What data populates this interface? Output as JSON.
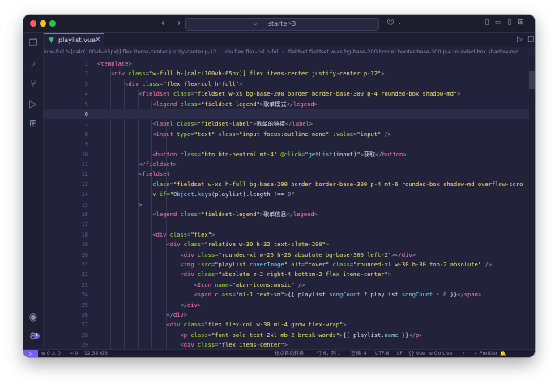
{
  "window": {
    "title": "starter-3"
  },
  "tab": {
    "filename": "playlist.vue",
    "close": "×",
    "icon": "vue-file-icon"
  },
  "breadcrumbs": [
    "iv.w-full.h-[calc(100vh-65px)].flex.items-center.justify-center.p-12",
    "div.flex.flex-col.h-full",
    "fieldset.fieldset.w-xs.bg-base-200.border.border-base-300.p-4.rounded-box.shadow-md"
  ],
  "editor": {
    "current_line": 6,
    "lines": [
      {
        "n": 1,
        "t": [
          [
            "<",
            "p"
          ],
          [
            "template",
            "tag"
          ],
          [
            ">",
            "p"
          ]
        ]
      },
      {
        "n": 2,
        "t": [
          [
            "    ",
            ""
          ],
          [
            "<",
            "p"
          ],
          [
            "div ",
            "tag"
          ],
          [
            "class",
            "attr"
          ],
          [
            "=",
            "p"
          ],
          [
            "\"w-full h-[calc(100vh-65px)] flex items-center justify-center p-12\"",
            "str"
          ],
          [
            ">",
            "p"
          ]
        ]
      },
      {
        "n": 3,
        "t": [
          [
            "        ",
            ""
          ],
          [
            "<",
            "p"
          ],
          [
            "div ",
            "tag"
          ],
          [
            "class",
            "attr"
          ],
          [
            "=",
            "p"
          ],
          [
            "\"flex flex-col h-full\"",
            "str"
          ],
          [
            ">",
            "p"
          ]
        ]
      },
      {
        "n": 4,
        "t": [
          [
            "            ",
            ""
          ],
          [
            "<",
            "p"
          ],
          [
            "fieldset ",
            "tag"
          ],
          [
            "class",
            "attr"
          ],
          [
            "=",
            "p"
          ],
          [
            "\"fieldset w-xs bg-base-200 border border-base-300 p-4 rounded-box shadow-md\"",
            "str"
          ],
          [
            ">",
            "p"
          ]
        ]
      },
      {
        "n": 5,
        "t": [
          [
            "                ",
            ""
          ],
          [
            "<",
            "p"
          ],
          [
            "legend ",
            "tag"
          ],
          [
            "class",
            "attr"
          ],
          [
            "=",
            "p"
          ],
          [
            "\"fieldset-legend\"",
            "str"
          ],
          [
            ">",
            "p"
          ],
          [
            "歌单模式",
            "txt"
          ],
          [
            "</",
            "p"
          ],
          [
            "legend",
            "tag"
          ],
          [
            ">",
            "p"
          ]
        ]
      },
      {
        "n": 6,
        "t": []
      },
      {
        "n": 7,
        "t": [
          [
            "                ",
            ""
          ],
          [
            "<",
            "p"
          ],
          [
            "label ",
            "tag"
          ],
          [
            "class",
            "attr"
          ],
          [
            "=",
            "p"
          ],
          [
            "\"fieldset-label\"",
            "str"
          ],
          [
            ">",
            "p"
          ],
          [
            "歌单的链接",
            "txt"
          ],
          [
            "</",
            "p"
          ],
          [
            "label",
            "tag"
          ],
          [
            ">",
            "p"
          ]
        ]
      },
      {
        "n": 8,
        "t": [
          [
            "                ",
            ""
          ],
          [
            "<",
            "p"
          ],
          [
            "input ",
            "tag"
          ],
          [
            "type",
            "attr"
          ],
          [
            "=",
            "p"
          ],
          [
            "\"text\" ",
            "str"
          ],
          [
            "class",
            "attr"
          ],
          [
            "=",
            "p"
          ],
          [
            "\"input focus:outline-none\" ",
            "str"
          ],
          [
            ":value",
            "attr"
          ],
          [
            "=",
            "p"
          ],
          [
            "\"input\"",
            "str"
          ],
          [
            " />",
            "p"
          ]
        ]
      },
      {
        "n": 9,
        "t": []
      },
      {
        "n": 10,
        "t": [
          [
            "                ",
            ""
          ],
          [
            "<",
            "p"
          ],
          [
            "button ",
            "tag"
          ],
          [
            "class",
            "attr"
          ],
          [
            "=",
            "p"
          ],
          [
            "\"btn btn-neutral mt-4\" ",
            "str"
          ],
          [
            "@click",
            "attr"
          ],
          [
            "=",
            "p"
          ],
          [
            "\"",
            "str"
          ],
          [
            "getList",
            "fn"
          ],
          [
            "(input)",
            "txt"
          ],
          [
            "\"",
            "str"
          ],
          [
            ">",
            "p"
          ],
          [
            "获取",
            "txt"
          ],
          [
            "</",
            "p"
          ],
          [
            "button",
            "tag"
          ],
          [
            ">",
            "p"
          ]
        ]
      },
      {
        "n": 11,
        "t": [
          [
            "            ",
            ""
          ],
          [
            "</",
            "p"
          ],
          [
            "fieldset",
            "tag"
          ],
          [
            ">",
            "p"
          ]
        ]
      },
      {
        "n": 12,
        "t": [
          [
            "            ",
            ""
          ],
          [
            "<",
            "p"
          ],
          [
            "fieldset",
            "tag"
          ]
        ]
      },
      {
        "n": 13,
        "t": [
          [
            "                ",
            ""
          ],
          [
            "class",
            "attr"
          ],
          [
            "=",
            "p"
          ],
          [
            "\"fieldset w-xs h-full bg-base-200 border border-base-300 p-4 mt-6 rounded-box shadow-md overflow-scro",
            "str"
          ]
        ]
      },
      {
        "n": 14,
        "t": [
          [
            "                ",
            ""
          ],
          [
            "v-if",
            "attr"
          ],
          [
            "=",
            "p"
          ],
          [
            "\"",
            "str"
          ],
          [
            "Object",
            "fn"
          ],
          [
            ".",
            "txt"
          ],
          [
            "keys",
            "fn"
          ],
          [
            "(playlist).length !== ",
            "txt"
          ],
          [
            "0",
            "num"
          ],
          [
            "\"",
            "str"
          ]
        ]
      },
      {
        "n": 15,
        "t": [
          [
            "            ",
            ""
          ],
          [
            ">",
            "p"
          ]
        ]
      },
      {
        "n": 16,
        "t": [
          [
            "                ",
            ""
          ],
          [
            "<",
            "p"
          ],
          [
            "legend ",
            "tag"
          ],
          [
            "class",
            "attr"
          ],
          [
            "=",
            "p"
          ],
          [
            "\"fieldset-legend\"",
            "str"
          ],
          [
            ">",
            "p"
          ],
          [
            "歌单信息",
            "txt"
          ],
          [
            "</",
            "p"
          ],
          [
            "legend",
            "tag"
          ],
          [
            ">",
            "p"
          ]
        ]
      },
      {
        "n": 17,
        "t": []
      },
      {
        "n": 18,
        "t": [
          [
            "                ",
            ""
          ],
          [
            "<",
            "p"
          ],
          [
            "div ",
            "tag"
          ],
          [
            "class",
            "attr"
          ],
          [
            "=",
            "p"
          ],
          [
            "\"flex\"",
            "str"
          ],
          [
            ">",
            "p"
          ]
        ]
      },
      {
        "n": 19,
        "t": [
          [
            "                    ",
            ""
          ],
          [
            "<",
            "p"
          ],
          [
            "div ",
            "tag"
          ],
          [
            "class",
            "attr"
          ],
          [
            "=",
            "p"
          ],
          [
            "\"relative w-30 h-32 text-slate-200\"",
            "str"
          ],
          [
            ">",
            "p"
          ]
        ]
      },
      {
        "n": 20,
        "t": [
          [
            "                        ",
            ""
          ],
          [
            "<",
            "p"
          ],
          [
            "div ",
            "tag"
          ],
          [
            "class",
            "attr"
          ],
          [
            "=",
            "p"
          ],
          [
            "\"rounded-xl w-26 h-26 absolute bg-base-300 left-2\"",
            "str"
          ],
          [
            "></",
            "p"
          ],
          [
            "div",
            "tag"
          ],
          [
            ">",
            "p"
          ]
        ]
      },
      {
        "n": 21,
        "t": [
          [
            "                        ",
            ""
          ],
          [
            "<",
            "p"
          ],
          [
            "img ",
            "tag"
          ],
          [
            ":src",
            "attr"
          ],
          [
            "=",
            "p"
          ],
          [
            "\"playlist.",
            "str"
          ],
          [
            "coverImage",
            "fn"
          ],
          [
            "\" ",
            "str"
          ],
          [
            "alt",
            "attr"
          ],
          [
            "=",
            "p"
          ],
          [
            "\"cover\" ",
            "str"
          ],
          [
            "class",
            "attr"
          ],
          [
            "=",
            "p"
          ],
          [
            "\"rounded-xl w-30 h-30 top-2 absolute\"",
            "str"
          ],
          [
            " />",
            "p"
          ]
        ]
      },
      {
        "n": 22,
        "t": [
          [
            "                        ",
            ""
          ],
          [
            "<",
            "p"
          ],
          [
            "div ",
            "tag"
          ],
          [
            "class",
            "attr"
          ],
          [
            "=",
            "p"
          ],
          [
            "\"absolute z-2 right-4 bottom-2 flex items-center\"",
            "str"
          ],
          [
            ">",
            "p"
          ]
        ]
      },
      {
        "n": 23,
        "t": [
          [
            "                            ",
            ""
          ],
          [
            "<",
            "p"
          ],
          [
            "Icon ",
            "tag"
          ],
          [
            "name",
            "attr"
          ],
          [
            "=",
            "p"
          ],
          [
            "\"akar-icons:music\"",
            "str"
          ],
          [
            " />",
            "p"
          ]
        ]
      },
      {
        "n": 24,
        "t": [
          [
            "                            ",
            ""
          ],
          [
            "<",
            "p"
          ],
          [
            "span ",
            "tag"
          ],
          [
            "class",
            "attr"
          ],
          [
            "=",
            "p"
          ],
          [
            "\"ml-1 text-sm\"",
            "str"
          ],
          [
            ">",
            "p"
          ],
          [
            "{{ playlist.",
            "txt"
          ],
          [
            "songCount",
            "fn"
          ],
          [
            " ? playlist.",
            "txt"
          ],
          [
            "songCount",
            "fn"
          ],
          [
            " : ",
            "txt"
          ],
          [
            "0",
            "num"
          ],
          [
            " }}",
            "txt"
          ],
          [
            "</",
            "p"
          ],
          [
            "span",
            "tag"
          ],
          [
            ">",
            "p"
          ]
        ]
      },
      {
        "n": 25,
        "t": [
          [
            "                        ",
            ""
          ],
          [
            "</",
            "p"
          ],
          [
            "div",
            "tag"
          ],
          [
            ">",
            "p"
          ]
        ]
      },
      {
        "n": 26,
        "t": [
          [
            "                    ",
            ""
          ],
          [
            "</",
            "p"
          ],
          [
            "div",
            "tag"
          ],
          [
            ">",
            "p"
          ]
        ]
      },
      {
        "n": 27,
        "t": [
          [
            "                    ",
            ""
          ],
          [
            "<",
            "p"
          ],
          [
            "div ",
            "tag"
          ],
          [
            "class",
            "attr"
          ],
          [
            "=",
            "p"
          ],
          [
            "\"flex flex-col w-30 ml-4 grow flex-wrap\"",
            "str"
          ],
          [
            ">",
            "p"
          ]
        ]
      },
      {
        "n": 28,
        "t": [
          [
            "                        ",
            ""
          ],
          [
            "<",
            "p"
          ],
          [
            "p ",
            "tag"
          ],
          [
            "class",
            "attr"
          ],
          [
            "=",
            "p"
          ],
          [
            "\"font-bold text-2xl mb-2 break-words\"",
            "str"
          ],
          [
            ">",
            "p"
          ],
          [
            "{{ playlist.",
            "txt"
          ],
          [
            "name",
            "fn"
          ],
          [
            " }}",
            "txt"
          ],
          [
            "</",
            "p"
          ],
          [
            "p",
            "tag"
          ],
          [
            ">",
            "p"
          ]
        ]
      },
      {
        "n": 29,
        "t": [
          [
            "                        ",
            ""
          ],
          [
            "<",
            "p"
          ],
          [
            "div ",
            "tag"
          ],
          [
            "class",
            "attr"
          ],
          [
            "=",
            "p"
          ],
          [
            "\"flex items-center\"",
            "str"
          ],
          [
            ">",
            "p"
          ]
        ]
      }
    ]
  },
  "colors": {
    "tag": "#ff79b0",
    "attr": "#a6e22e",
    "str": "#f1e56e",
    "p": "#9a9ab8",
    "txt": "#e6e6f2",
    "fn": "#7fd8f0",
    "num": "#bd93f9"
  },
  "status": {
    "remote": "⤬",
    "problems": "⊗ 0 ⚠ 0",
    "ports": "⌁ 0",
    "size": "12.34 KiB",
    "translate": "标点自动转换",
    "position": "行 6，列 1",
    "spaces": "空格: 4",
    "encoding": "UTF-8",
    "eol": "LF",
    "language": "{} Vue",
    "golive": "⊚ Go Live",
    "check": "✓",
    "prettier": "✓ Prettier",
    "bell": "🔔"
  },
  "accounts_badge": "1"
}
